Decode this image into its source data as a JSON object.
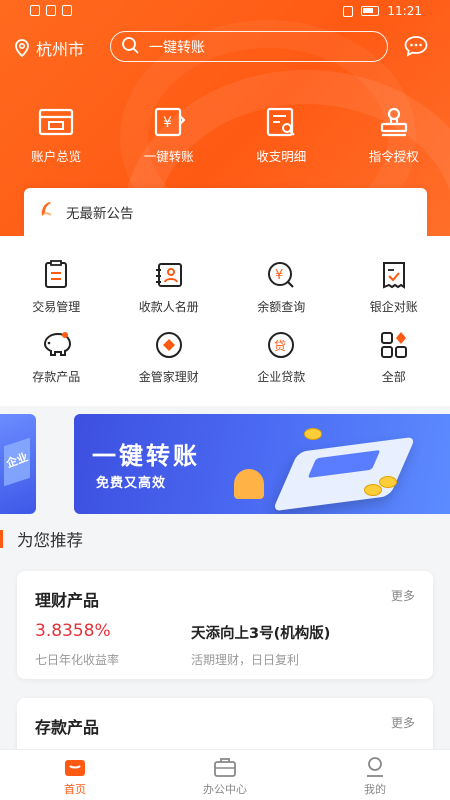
{
  "status_bar": {
    "time": "11:21"
  },
  "header": {
    "city": "杭州市",
    "search_placeholder": "一键转账",
    "quick_actions": [
      {
        "label": "账户总览",
        "icon": "account-overview-icon"
      },
      {
        "label": "一键转账",
        "icon": "transfer-icon"
      },
      {
        "label": "收支明细",
        "icon": "statement-icon"
      },
      {
        "label": "指令授权",
        "icon": "authorize-icon"
      }
    ]
  },
  "notice": {
    "text": "无最新公告"
  },
  "services": [
    {
      "label": "交易管理",
      "icon": "transaction-icon"
    },
    {
      "label": "收款人名册",
      "icon": "payee-book-icon"
    },
    {
      "label": "余额查询",
      "icon": "balance-icon"
    },
    {
      "label": "银企对账",
      "icon": "reconcile-icon"
    },
    {
      "label": "存款产品",
      "icon": "piggy-bank-icon"
    },
    {
      "label": "金管家理财",
      "icon": "wealth-icon"
    },
    {
      "label": "企业贷款",
      "icon": "loan-icon"
    },
    {
      "label": "全部",
      "icon": "all-apps-icon"
    }
  ],
  "banner": {
    "title": "一键转账",
    "subtitle": "免费又高效",
    "side_text": "企业"
  },
  "recommend": {
    "title": "为您推荐",
    "cards": [
      {
        "title": "理财产品",
        "more": "更多",
        "rate": "3.8358%",
        "rate_label": "七日年化收益率",
        "product_name": "天添向上3号(机构版)",
        "product_desc": "活期理财，日日复利"
      },
      {
        "title": "存款产品",
        "more": "更多"
      }
    ]
  },
  "tabs": [
    {
      "label": "首页",
      "icon": "home-icon",
      "active": true
    },
    {
      "label": "办公中心",
      "icon": "briefcase-icon",
      "active": false
    },
    {
      "label": "我的",
      "icon": "profile-icon",
      "active": false
    }
  ],
  "colors": {
    "brand": "#ff5a14",
    "rate": "#e5313a",
    "banner": "#4b6bf3"
  }
}
